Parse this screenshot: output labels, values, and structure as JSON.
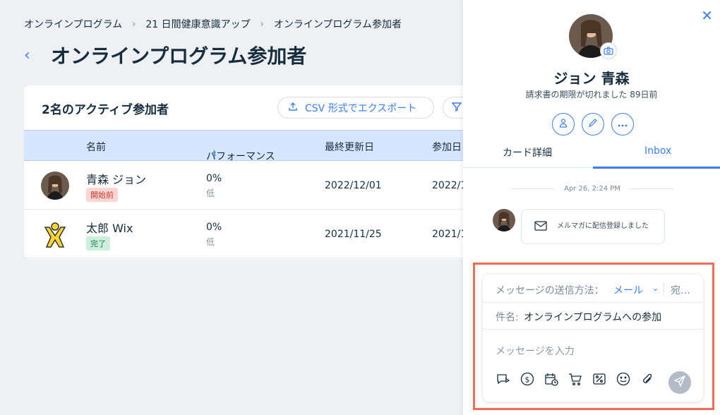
{
  "breadcrumb": {
    "items": [
      "オンラインプログラム",
      "21 日間健康意識アップ",
      "オンラインプログラム参加者"
    ],
    "separator": "›"
  },
  "page": {
    "title": "オンラインプログラム参加者"
  },
  "card": {
    "title": "2名のアクティブ参加者",
    "export_label": "CSV 形式でエクスポート",
    "columns": [
      "名前",
      "パフォーマンス",
      "最終更新日",
      "参加日"
    ],
    "sort_indicator": "↓",
    "rows": [
      {
        "name": "青森 ジョン",
        "status": "開始前",
        "performance": "0%",
        "performance_sub": "低",
        "last_updated": "2022/12/01",
        "joined": "2022/1"
      },
      {
        "name": "太郎 Wix",
        "status": "完了",
        "performance": "0%",
        "performance_sub": "低",
        "last_updated": "2021/11/25",
        "joined": "2021/1"
      }
    ]
  },
  "panel": {
    "name": "ジョン 青森",
    "subtitle": "請求書の期限が切れました 89日前",
    "tabs": [
      "カード詳細",
      "Inbox"
    ],
    "active_tab": "Inbox",
    "timestamp": "Apr 26, 2:24 PM",
    "message_text": "メルマガに配信登録しました",
    "composer": {
      "method_label": "メッセージの送信方法：",
      "method_value": "メール",
      "to_label": "宛…",
      "subject_label": "件名:",
      "subject_value": "オンラインプログラムへの参加",
      "message_placeholder": "メッセージを入力"
    }
  },
  "colors": {
    "accent": "#3b7ef6",
    "highlight_outline": "#ef6e55",
    "table_header_bg": "#d6e6fe"
  }
}
